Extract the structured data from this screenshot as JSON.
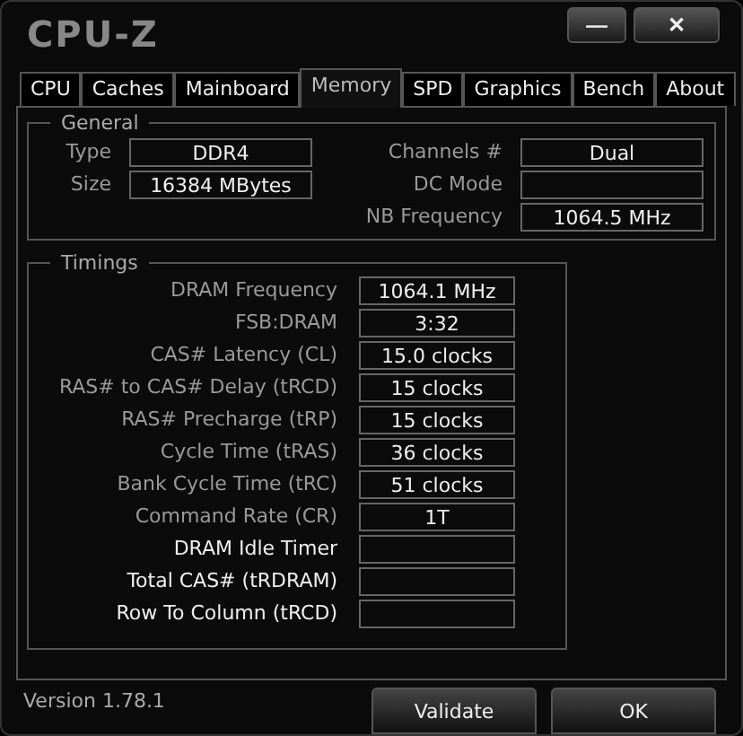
{
  "window": {
    "title": "CPU-Z",
    "controls": [
      {
        "kind": "minimize",
        "label": "—"
      },
      {
        "kind": "close",
        "label": "✕"
      }
    ]
  },
  "tabs": [
    {
      "label": "CPU",
      "selected": false
    },
    {
      "label": "Caches",
      "selected": false
    },
    {
      "label": "Mainboard",
      "selected": false
    },
    {
      "label": "Memory",
      "selected": true
    },
    {
      "label": "SPD",
      "selected": false
    },
    {
      "label": "Graphics",
      "selected": false
    },
    {
      "label": "Bench",
      "selected": false
    },
    {
      "label": "About",
      "selected": false
    }
  ],
  "general": {
    "title": "General",
    "left": [
      {
        "label": "Type",
        "value": "DDR4"
      },
      {
        "label": "Size",
        "value": "16384 MBytes"
      }
    ],
    "right": [
      {
        "label": "Channels #",
        "value": "Dual"
      },
      {
        "label": "DC Mode"
      },
      {
        "label": "NB Frequency",
        "value": "1064.5 MHz"
      }
    ]
  },
  "timings": {
    "title": "Timings",
    "rows": [
      {
        "label": "DRAM Frequency",
        "value": "1064.1 MHz",
        "greyed": true
      },
      {
        "label": "FSB:DRAM",
        "value": "3:32",
        "greyed": true
      },
      {
        "label": "CAS# Latency (CL)",
        "value": "15.0 clocks",
        "greyed": true
      },
      {
        "label": "RAS# to CAS# Delay (tRCD)",
        "value": "15 clocks",
        "greyed": true
      },
      {
        "label": "RAS# Precharge (tRP)",
        "value": "15 clocks",
        "greyed": true
      },
      {
        "label": "Cycle Time (tRAS)",
        "value": "36 clocks",
        "greyed": true
      },
      {
        "label": "Bank Cycle Time (tRC)",
        "value": "51 clocks",
        "greyed": true
      },
      {
        "label": "Command Rate (CR)",
        "value": "1T",
        "greyed": true
      },
      {
        "label": "DRAM Idle Timer",
        "greyed": false
      },
      {
        "label": "Total CAS# (tRDRAM)",
        "greyed": false
      },
      {
        "label": "Row To Column (tRCD)",
        "greyed": false
      }
    ]
  },
  "footer": {
    "version": "Version 1.78.1",
    "buttons": [
      "Validate",
      "OK"
    ]
  }
}
